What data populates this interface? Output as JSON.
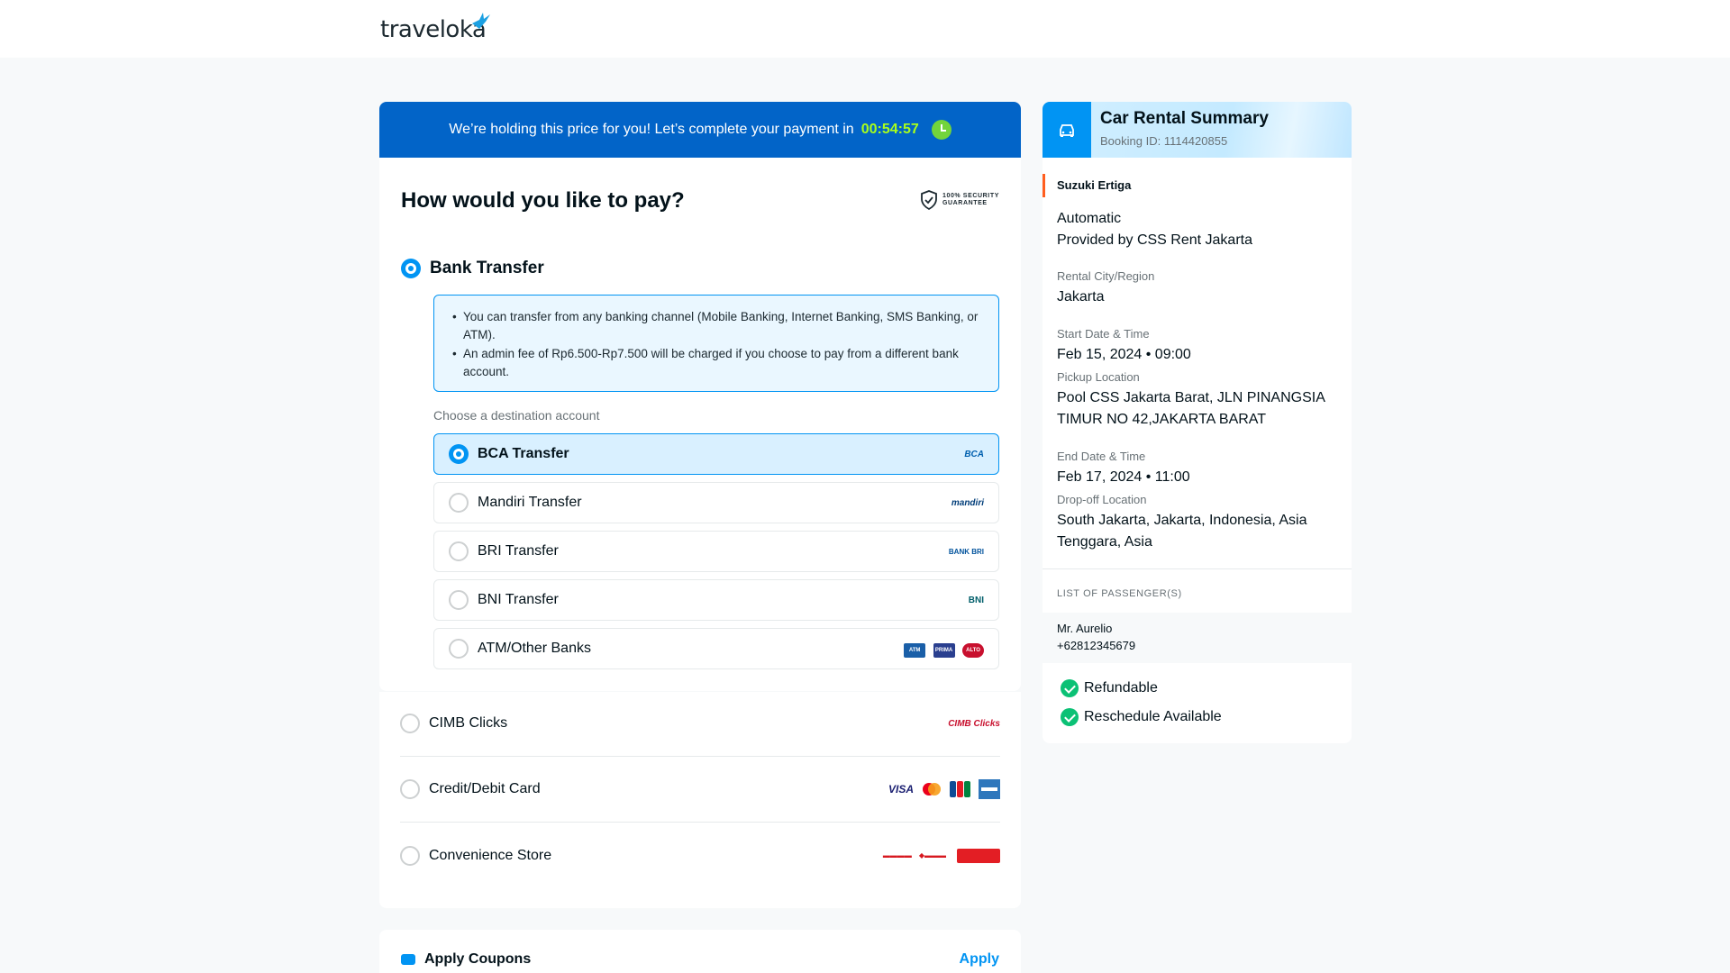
{
  "header": {
    "logo_text": "traveloka"
  },
  "timer": {
    "message": "We’re holding this price for you! Let’s complete your payment in",
    "countdown": "00:54:57"
  },
  "payment": {
    "title": "How would you like to pay?",
    "security_line1": "100% SECURITY",
    "security_line2": "GUARANTEE",
    "bank_transfer": {
      "label": "Bank Transfer",
      "info": [
        "You can transfer from any banking channel (Mobile Banking, Internet Banking, SMS Banking, or ATM).",
        "An admin fee of Rp6.500-Rp7.500 will be charged if you choose to pay from a different bank account."
      ],
      "destination_label": "Choose a destination account",
      "banks": [
        {
          "label": "BCA Transfer",
          "logo": "BCA",
          "selected": true
        },
        {
          "label": "Mandiri Transfer",
          "logo": "mandiri",
          "selected": false
        },
        {
          "label": "BRI Transfer",
          "logo": "BANK BRI",
          "selected": false
        },
        {
          "label": "BNI Transfer",
          "logo": "BNI",
          "selected": false
        },
        {
          "label": "ATM/Other Banks",
          "logo": "ATM PRIMA ALTO",
          "selected": false
        }
      ]
    },
    "other_methods": [
      {
        "label": "CIMB Clicks",
        "logo": "CIMB Clicks"
      },
      {
        "label": "Credit/Debit Card",
        "logo": "VISA"
      },
      {
        "label": "Convenience Store",
        "logo": "Alfamart Alfamidi Indomaret"
      }
    ]
  },
  "coupon": {
    "label": "Apply Coupons",
    "action": "Apply"
  },
  "summary": {
    "title": "Car Rental Summary",
    "booking_id": "Booking ID:  1114420855",
    "car_name": "Suzuki Ertiga",
    "transmission": "Automatic",
    "provider": "Provided by CSS Rent Jakarta",
    "city_label": "Rental City/Region",
    "city": "Jakarta",
    "start_label": "Start Date & Time",
    "start": "Feb 15, 2024 • 09:00",
    "pickup_label": "Pickup Location",
    "pickup_line1": "Pool CSS Jakarta Barat, JLN PINANGSIA",
    "pickup_line2": "TIMUR NO 42,JAKARTA BARAT",
    "end_label": "End Date & Time",
    "end": "Feb 17, 2024 • 11:00",
    "dropoff_label": "Drop-off Location",
    "dropoff_line1": "South Jakarta, Jakarta, Indonesia, Asia",
    "dropoff_line2": "Tenggara, Asia",
    "passengers_label": "LIST OF PASSENGER(S)",
    "passenger_name": "Mr. Aurelio",
    "passenger_phone": "+62812345679",
    "features": [
      "Refundable",
      "Reschedule Available"
    ]
  }
}
